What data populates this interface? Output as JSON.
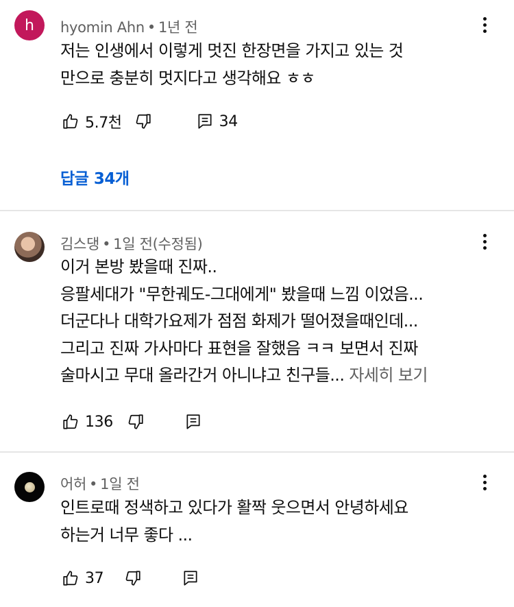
{
  "comments": [
    {
      "avatar_letter": "h",
      "author": "hyomin Ahn",
      "time": "1년 전",
      "lines": [
        "저는 인생에서 이렇게 멋진 한장면을 가지고 있는 것",
        "만으로 충분히 멋지다고 생각해요 ㅎㅎ"
      ],
      "likes": "5.7천",
      "reply_count": "34",
      "view_replies": "답글 34개"
    },
    {
      "author": "김스댕",
      "time": "1일 전(수정됨)",
      "lines": [
        "이거 본방 봤을때 진짜..",
        "응팔세대가 \"무한궤도-그대에게\" 봤을때 느낌 이었음...",
        "더군다나 대학가요제가 점점 화제가 떨어졌을때인데...",
        "그리고 진짜 가사마다 표현을 잘했음 ㅋㅋ 보면서 진짜",
        "술마시고 무대 올라간거 아니냐고 친구들..."
      ],
      "read_more": "자세히 보기",
      "likes": "136"
    },
    {
      "author": "어허",
      "time": "1일 전",
      "lines": [
        "인트로때 정색하고 있다가 활짝 웃으면서 안녕하세요",
        "하는거 너무 좋다 ..."
      ],
      "likes": "37"
    }
  ],
  "separator": "•",
  "icons": {
    "like": "thumbs-up-icon",
    "dislike": "thumbs-down-icon",
    "reply": "reply-icon",
    "menu": "kebab-menu-icon"
  },
  "colors": {
    "link": "#065fd4",
    "meta": "#606060",
    "avatar_h": "#c2185b"
  }
}
